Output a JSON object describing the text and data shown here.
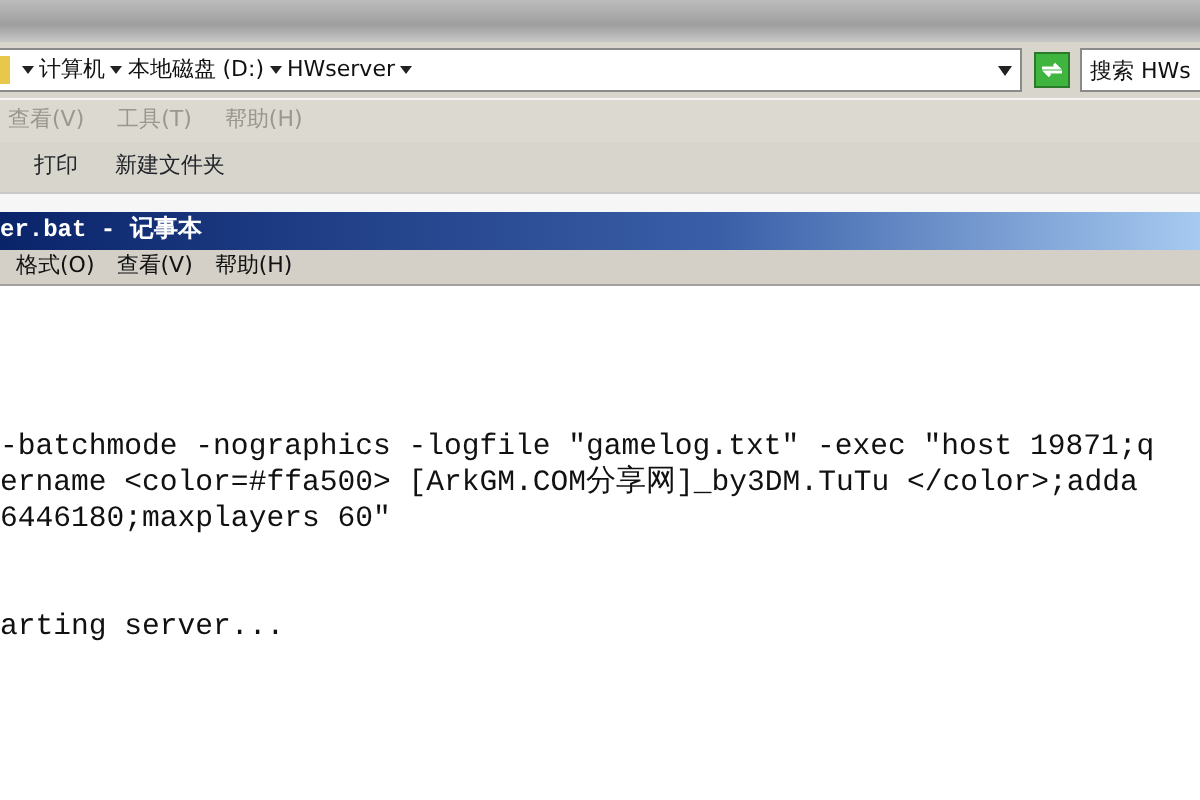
{
  "explorer": {
    "address": {
      "segments": [
        "计算机",
        "本地磁盘 (D:)",
        "HWserver"
      ]
    },
    "search": {
      "placeholder": "搜索 HWs"
    },
    "menu": [
      {
        "label": "查看(V)",
        "disabled": true
      },
      {
        "label": "工具(T)",
        "disabled": true
      },
      {
        "label": "帮助(H)",
        "disabled": true
      }
    ],
    "toolbar": [
      "打印",
      "新建文件夹"
    ]
  },
  "notepad": {
    "title": "er.bat - 记事本",
    "menu": [
      "格式(O)",
      "查看(V)",
      "帮助(H)"
    ],
    "blocks": [
      {
        "lines": [
          "-batchmode -nographics -logfile \"gamelog.txt\" -exec \"host 19871;q",
          "ername <color=#ffa500> [ArkGM.COM分享网]_by3DM.TuTu </color>;adda",
          "6446180;maxplayers 60\""
        ]
      },
      {
        "lines": [
          "arting server..."
        ]
      }
    ]
  }
}
